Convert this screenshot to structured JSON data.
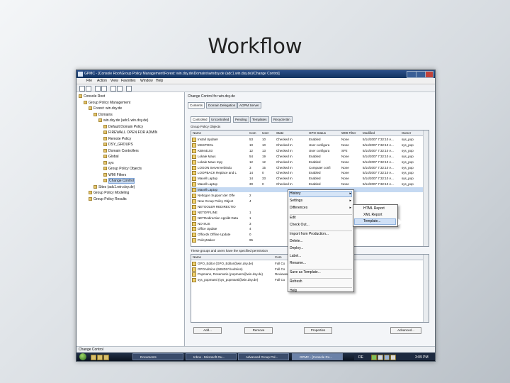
{
  "slide": {
    "title": "Workflow"
  },
  "window": {
    "title": "GPMC - [Console Root\\Group Policy Management\\Forest: win.dsy.de\\Domains\\windsy.de (adc1.win.dsy.de)\\Change Control]"
  },
  "menu": [
    "File",
    "Action",
    "View",
    "Favorites",
    "Window",
    "Help"
  ],
  "tree": [
    {
      "label": "Console Root",
      "indent": 0
    },
    {
      "label": "Group Policy Management",
      "indent": 1
    },
    {
      "label": "Forest: win.dsy.de",
      "indent": 2
    },
    {
      "label": "Domains",
      "indent": 3
    },
    {
      "label": "win.dsy.de (adc1.win.dsy.de)",
      "indent": 4
    },
    {
      "label": "Default Domain Policy",
      "indent": 5
    },
    {
      "label": "FIREWALL OPEN FOR ADMIN",
      "indent": 5
    },
    {
      "label": "Remote Policy",
      "indent": 5
    },
    {
      "label": "DSY_GROUPS",
      "indent": 5
    },
    {
      "label": "Domain Controllers",
      "indent": 5
    },
    {
      "label": "Global",
      "indent": 5
    },
    {
      "label": "sys",
      "indent": 5
    },
    {
      "label": "Group Policy Objects",
      "indent": 5
    },
    {
      "label": "WMI Filters",
      "indent": 5
    },
    {
      "label": "Change Control",
      "indent": 5,
      "selected": true
    },
    {
      "label": "Sites (adc1.win.dsy.de)",
      "indent": 3
    },
    {
      "label": "Group Policy Modeling",
      "indent": 2
    },
    {
      "label": "Group Policy Results",
      "indent": 2
    }
  ],
  "right": {
    "header": "Change Control for win.dsy.de",
    "tabs": [
      "Contents",
      "Domain Delegation",
      "AGPM Server"
    ],
    "subtabs": [
      "Controlled",
      "Uncontrolled",
      "Pending",
      "Templates",
      "Recycle Bin"
    ],
    "group_label": "Group Policy Objects",
    "columns": [
      "Name",
      "Com",
      "User",
      "State",
      "GPO Status",
      "WMI Filter",
      "Modified",
      "Owner"
    ],
    "rows": [
      [
        "Install Updater",
        "53",
        "10",
        "Checked In",
        "Enabled",
        "None",
        "5/14/2007 7:32:10 A...",
        "sys_pop"
      ],
      [
        "MSSPOOL",
        "10",
        "10",
        "Checked In",
        "User configura",
        "None",
        "5/14/2007 7:32:10 A...",
        "sys_pop"
      ],
      [
        "KB944103",
        "12",
        "13",
        "Checked In",
        "User configura",
        "SP2",
        "5/14/2007 7:32:10 A...",
        "sys_pop"
      ],
      [
        "Lokale Maus",
        "54",
        "19",
        "Checked In",
        "Enabled",
        "None",
        "5/14/2007 7:32:10 A...",
        "sys_pop"
      ],
      [
        "Lokale Maus mpy",
        "12",
        "12",
        "Checked In",
        "Enabled",
        "None",
        "5/14/2007 7:32:10 A...",
        "sys_pop"
      ],
      [
        "LOGON Serververbindu",
        "3",
        "15",
        "Checked In",
        "Computer confi",
        "None",
        "5/14/2007 7:32:10 A...",
        "sys_pop"
      ],
      [
        "LOOPBACK Replace and L",
        "14",
        "0",
        "Checked In",
        "Enabled",
        "None",
        "5/14/2007 7:32:10 A...",
        "sys_pop"
      ],
      [
        "Maxell Laptop",
        "14",
        "33",
        "Checked In",
        "Enabled",
        "None",
        "5/14/2007 7:32:10 A...",
        "sys_pop"
      ],
      [
        "Maxell Laptop",
        "30",
        "0",
        "Checked In",
        "Enabled",
        "None",
        "5/14/2007 7:32:10 A...",
        "sys_pop"
      ],
      [
        "Maxell Laptop",
        "",
        "",
        "",
        "",
        "",
        "",
        ""
      ],
      [
        "Netlogon Support der Offe",
        "2",
        "",
        "",
        "",
        "",
        "",
        ""
      ],
      [
        "New Group Policy Object",
        "4",
        "",
        "",
        "",
        "",
        "",
        ""
      ],
      [
        "NETOOLER REDIRECTIO",
        "",
        "",
        "",
        "",
        "",
        "",
        ""
      ],
      [
        "NETOFFLINE",
        "1",
        "",
        "",
        "",
        "",
        "",
        ""
      ],
      [
        "NETRedirection Applikt Data",
        "1",
        "",
        "",
        "",
        "",
        "",
        ""
      ],
      [
        "NO-SUS",
        "3",
        "",
        "",
        "",
        "",
        "",
        ""
      ],
      [
        "Office Update",
        "4",
        "",
        "",
        "",
        "",
        "",
        ""
      ],
      [
        "Office2k Offline Update",
        "0",
        "",
        "",
        "",
        "",
        "",
        ""
      ],
      [
        "PolicyMaker",
        "95",
        "",
        "",
        "",
        "",
        "",
        ""
      ]
    ],
    "history_label": "These groups and users have the specified permission",
    "history_columns": [
      "Name",
      "Com",
      "User"
    ],
    "history_rows": [
      [
        "GPO_Editor (GPO_Editor@win.dsy.de)",
        "Full Co",
        ""
      ],
      [
        "GPOAdmins (WINDSY\\Admins)",
        "Full Co",
        ""
      ],
      [
        "Popmann, Rosemarie (popmann@win.dsy.de)",
        "Reviewer",
        ""
      ],
      [
        "sys_popmanti (sys_popmanti@win.dsy.de)",
        "Full Co",
        ""
      ]
    ],
    "buttons": {
      "add": "Add...",
      "remove": "Remove",
      "properties": "Properties",
      "advanced": "Advanced..."
    }
  },
  "context_menu": {
    "items": [
      {
        "label": "History",
        "arrow": true,
        "highlighted": true
      },
      {
        "label": "Settings",
        "arrow": true
      },
      {
        "label": "Differences",
        "arrow": true
      },
      {
        "label": "Edit",
        "sep_before": true
      },
      {
        "label": "Check Out..."
      },
      {
        "label": "Import from Production...",
        "sep_before": true
      },
      {
        "label": "Delete..."
      },
      {
        "label": "Deploy..."
      },
      {
        "label": "Label..."
      },
      {
        "label": "Rename..."
      },
      {
        "label": "Save as Template...",
        "sep_before": true
      },
      {
        "label": "Refresh",
        "sep_before": true
      },
      {
        "label": "Help",
        "sep_before": true
      }
    ],
    "submenu": [
      {
        "label": "HTML Report"
      },
      {
        "label": "XML Report"
      },
      {
        "label": "Template...",
        "highlighted": true
      }
    ]
  },
  "statusbar": {
    "text": "Change Control"
  },
  "taskbar": {
    "tasks": [
      {
        "label": "Documents"
      },
      {
        "label": "Inbox - Microsoft Ou..."
      },
      {
        "label": "Advanced Group Pol..."
      },
      {
        "label": "GPMC - [Console Ro...",
        "active": true
      }
    ],
    "lang": "DE",
    "clock": "3:09 PM"
  }
}
